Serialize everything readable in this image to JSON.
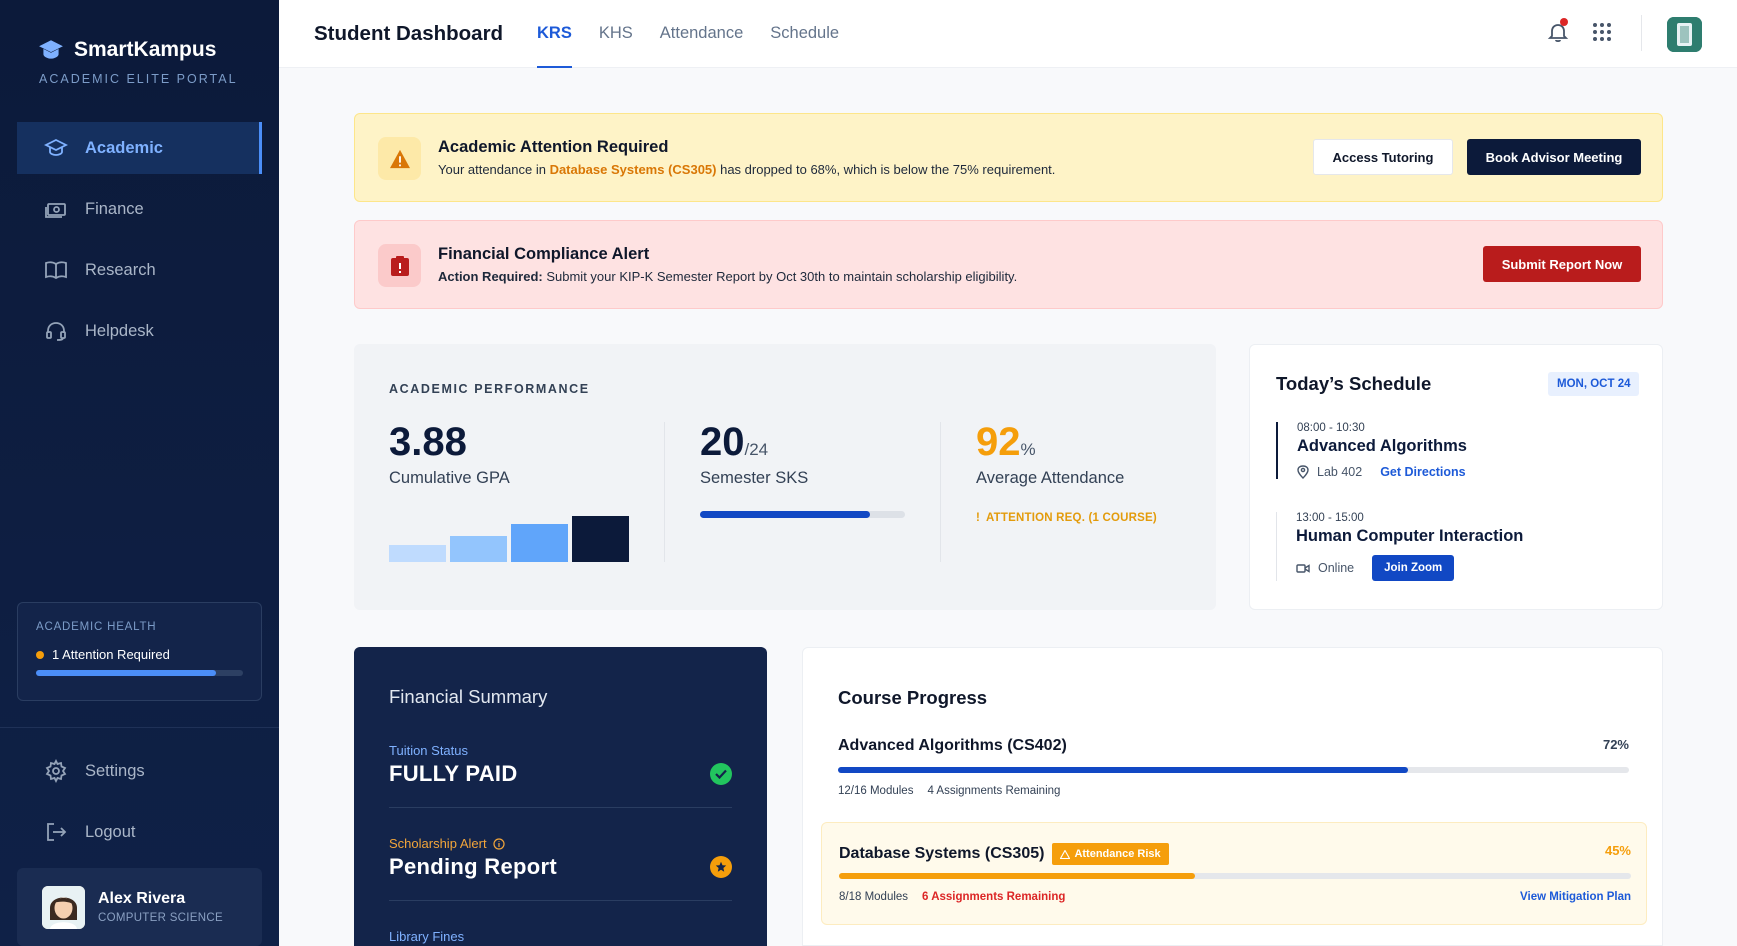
{
  "sidebar": {
    "brand_name": "SmartKampus",
    "brand_sub": "ACADEMIC ELITE PORTAL",
    "items": [
      {
        "label": "Academic",
        "icon": "graduation-cap-icon",
        "active": true
      },
      {
        "label": "Finance",
        "icon": "money-icon"
      },
      {
        "label": "Research",
        "icon": "book-icon"
      },
      {
        "label": "Helpdesk",
        "icon": "headset-icon"
      }
    ],
    "health": {
      "title": "ACADEMIC HEALTH",
      "status": "1 Attention Required",
      "progress": 0.87
    },
    "bottom_items": [
      {
        "label": "Settings",
        "icon": "gear-icon"
      },
      {
        "label": "Logout",
        "icon": "logout-icon"
      }
    ],
    "user": {
      "name": "Alex Rivera",
      "dept": "COMPUTER SCIENCE"
    }
  },
  "header": {
    "title": "Student Dashboard",
    "tabs": [
      {
        "label": "KRS",
        "active": true
      },
      {
        "label": "KHS"
      },
      {
        "label": "Attendance"
      },
      {
        "label": "Schedule"
      }
    ]
  },
  "alerts": {
    "academic": {
      "title": "Academic Attention Required",
      "text_before": "Your attendance in ",
      "highlight": "Database Systems (CS305)",
      "text_after": " has dropped to 68%, which is below the 75% requirement.",
      "btn_tutoring": "Access Tutoring",
      "btn_advisor": "Book Advisor Meeting"
    },
    "financial": {
      "title": "Financial Compliance Alert",
      "strong": "Action Required:",
      "text": " Submit your KIP-K Semester Report by Oct 30th to maintain scholarship eligibility.",
      "btn_submit": "Submit Report Now"
    }
  },
  "performance": {
    "label": "ACADEMIC PERFORMANCE",
    "gpa": {
      "value": "3.88",
      "label": "Cumulative GPA",
      "bars": [
        0.35,
        0.55,
        0.8,
        0.95
      ]
    },
    "sks": {
      "value": "20",
      "total": "/24",
      "label": "Semester SKS",
      "progress": 0.83
    },
    "attendance": {
      "value": "92",
      "unit": "%",
      "label": "Average Attendance",
      "warning": "ATTENTION REQ. (1 COURSE)"
    }
  },
  "schedule": {
    "title": "Today’s Schedule",
    "date": "MON, OCT 24",
    "items": [
      {
        "time": "08:00 - 10:30",
        "name": "Advanced Algorithms",
        "location": "Lab 402",
        "action": "Get Directions"
      },
      {
        "time": "13:00 - 15:00",
        "name": "Human Computer Interaction",
        "location": "Online",
        "action": "Join Zoom"
      }
    ]
  },
  "financial": {
    "title": "Financial Summary",
    "tuition_label": "Tuition Status",
    "tuition_value": "FULLY PAID",
    "scholarship_label": "Scholarship Alert",
    "scholarship_value": "Pending Report",
    "library_label": "Library Fines"
  },
  "courses": {
    "title": "Course Progress",
    "items": [
      {
        "name": "Advanced Algorithms (CS402)",
        "pct": "72%",
        "progress": 0.72,
        "modules": "12/16 Modules",
        "assignments": "4 Assignments Remaining"
      },
      {
        "name": "Database Systems (CS305)",
        "badge": "Attendance Risk",
        "pct": "45%",
        "progress": 0.45,
        "modules": "8/18 Modules",
        "assignments": "6 Assignments Remaining",
        "action": "View Mitigation Plan"
      }
    ]
  },
  "colors": {
    "primary": "#1d5ad8",
    "navy": "#0c1a3a",
    "warning": "#f59e0b",
    "danger": "#b91c1c",
    "success": "#22c55e"
  }
}
